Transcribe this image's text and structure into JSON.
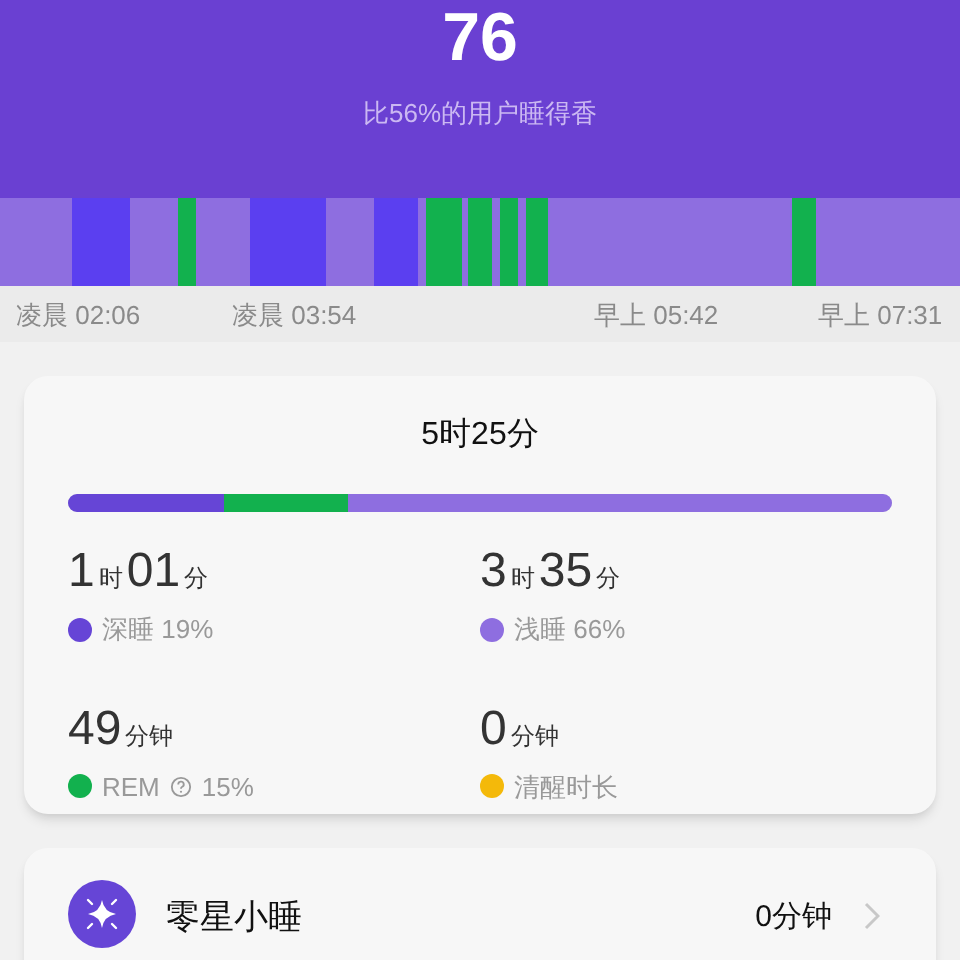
{
  "header": {
    "score": "76",
    "comparison": "比56%的用户睡得香"
  },
  "timeline": {
    "times": [
      "凌晨 02:06",
      "凌晨 03:54",
      "早上 05:42",
      "早上 07:31"
    ]
  },
  "summary": {
    "total": "5时25分",
    "bar": [
      {
        "color": "#6645d6"
      },
      {
        "color": "#12b14e"
      },
      {
        "color": "#8e6ee0"
      }
    ],
    "stats": [
      {
        "value": [
          {
            "n": "1",
            "u": "时"
          },
          {
            "n": "01",
            "u": "分"
          }
        ],
        "label": "深睡 19%",
        "color": "#6645d6",
        "help": false
      },
      {
        "value": [
          {
            "n": "3",
            "u": "时"
          },
          {
            "n": "35",
            "u": "分"
          }
        ],
        "label": "浅睡 66%",
        "color": "#8e6ee0",
        "help": false
      },
      {
        "value": [
          {
            "n": "49",
            "u": "分钟"
          }
        ],
        "label": "REM",
        "extra": "15%",
        "color": "#12b14e",
        "help": true
      },
      {
        "value": [
          {
            "n": "0",
            "u": "分钟"
          }
        ],
        "label": "清醒时长",
        "color": "#f4b90a",
        "help": false
      }
    ]
  },
  "nap": {
    "label": "零星小睡",
    "value": "0分钟"
  }
}
